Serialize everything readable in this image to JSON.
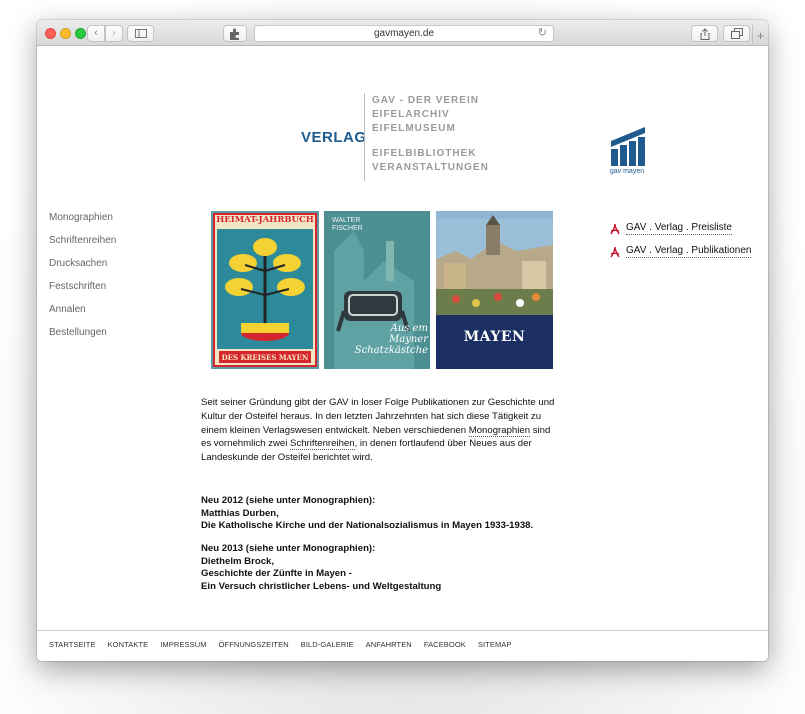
{
  "browser": {
    "url": "gavmayen.de"
  },
  "header": {
    "section_title": "VERLAG",
    "links_top": [
      "GAV - DER VEREIN",
      "EIFELARCHIV",
      "EIFELMUSEUM"
    ],
    "links_bottom": [
      "EIFELBIBLIOTHEK",
      "VERANSTALTUNGEN"
    ],
    "logo_caption": "gav mayen",
    "brand_color": "#1f5b8f"
  },
  "sidebar": {
    "items": [
      "Monographien",
      "Schriftenreihen",
      "Drucksachen",
      "Festschriften",
      "Annalen",
      "Bestellungen"
    ]
  },
  "covers": {
    "cover1_top": "HEIMAT-JAHRBUCH",
    "cover1_bottom": "DES KREISES MAYEN",
    "cover2_author": "WALTER FISCHER",
    "cover2_title": "Aus em Mayner Schatzkästche",
    "cover3_title": "MAYEN"
  },
  "downloads": {
    "items": [
      "GAV . Verlag . Preisliste",
      "GAV . Verlag . Publikationen"
    ]
  },
  "intro": {
    "part1": "Seit seiner Gründung gibt der GAV in loser Folge Publikationen zur Geschichte und Kultur der Osteifel heraus. In den letzten Jahrzehnten hat sich diese Tätigkeit zu einem kleinen Verlagswesen entwickelt. Neben verschiedenen ",
    "link1": "Monographien",
    "part2": " sind es vornehmlich zwei ",
    "link2": "Schriftenreihen",
    "part3": ", in denen fortlaufend über Neues aus der Landeskunde der Osteifel berichtet wird."
  },
  "news": [
    {
      "line1": "Neu 2012 (siehe unter Monographien):",
      "line2": "Matthias Durben,",
      "line3": "Die Katholische Kirche und der Nationalsozialismus in Mayen 1933-1938."
    },
    {
      "line1": "Neu 2013 (siehe unter Monographien):",
      "line2": "Diethelm Brock,",
      "line3": "Geschichte der Zünfte in Mayen -",
      "line4": "Ein Versuch christlicher Lebens- und Weltgestaltung"
    }
  ],
  "footer": {
    "items": [
      "STARTSEITE",
      "KONTAKTE",
      "IMPRESSUM",
      "ÖFFNUNGSZEITEN",
      "BILD-GALERIE",
      "ANFAHRTEN",
      "FACEBOOK",
      "SITEMAP"
    ]
  }
}
